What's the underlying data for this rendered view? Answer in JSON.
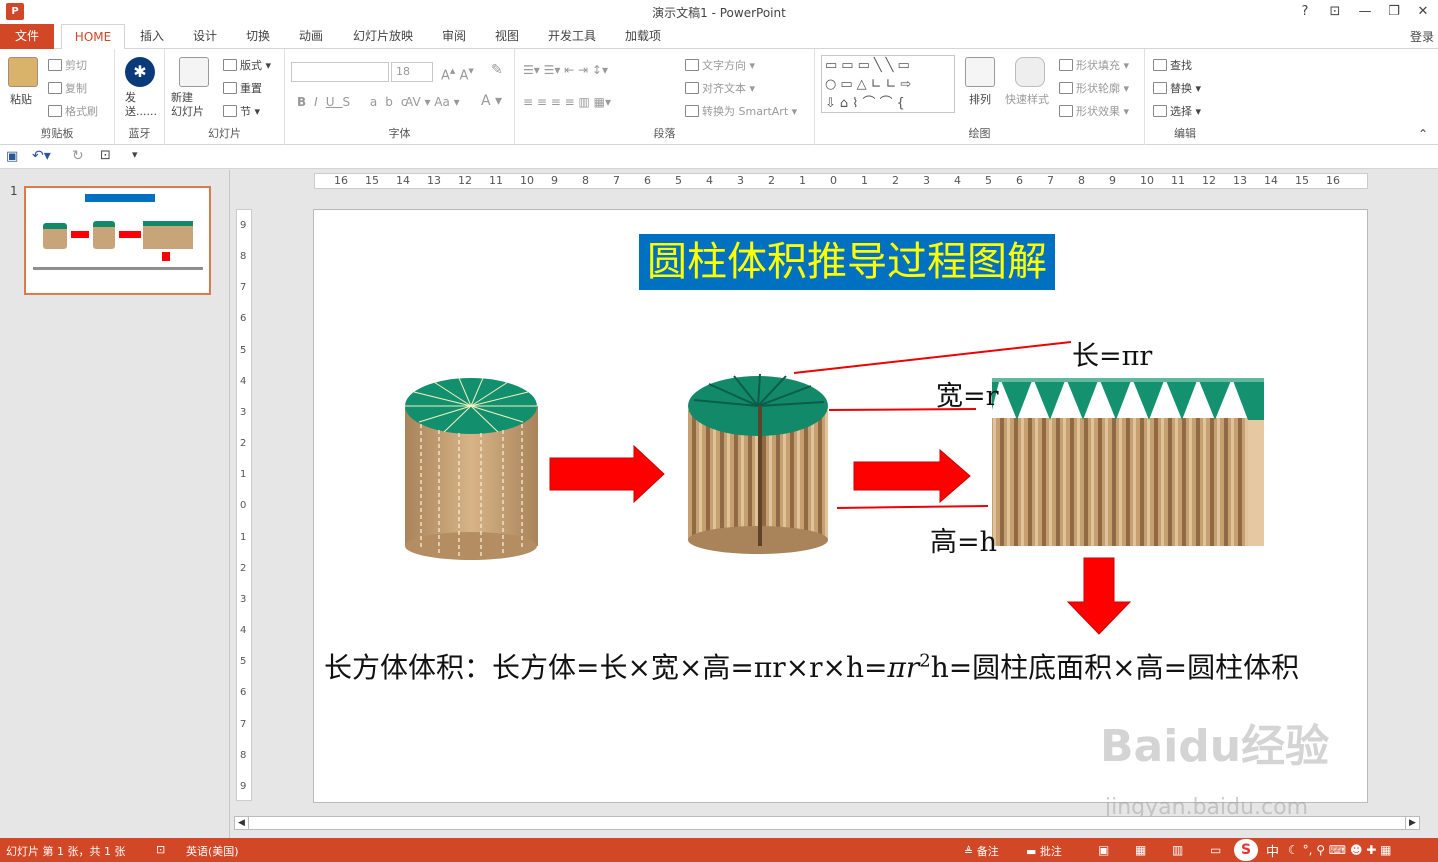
{
  "window": {
    "title": "演示文稿1 - PowerPoint",
    "help": "?",
    "login": "登录"
  },
  "tabs": {
    "file": "文件",
    "home": "HOME",
    "insert": "插入",
    "design": "设计",
    "transitions": "切换",
    "animations": "动画",
    "slideshow": "幻灯片放映",
    "review": "审阅",
    "view": "视图",
    "developer": "开发工具",
    "addins": "加载项"
  },
  "ribbon": {
    "clipboard": {
      "label": "剪贴板",
      "paste": "粘贴",
      "cut": "剪切",
      "copy": "复制",
      "format_painter": "格式刷"
    },
    "bluetooth": {
      "label": "蓝牙",
      "send": "发送......"
    },
    "slides": {
      "label": "幻灯片",
      "new_slide": "新建\n幻灯片",
      "layout": "版式",
      "reset": "重置",
      "section": "节"
    },
    "font": {
      "label": "字体",
      "size": "18"
    },
    "paragraph": {
      "label": "段落",
      "text_direction": "文字方向",
      "align_text": "对齐文本",
      "smartart": "转换为 SmartArt"
    },
    "drawing": {
      "label": "绘图",
      "arrange": "排列",
      "quick_styles": "快速样式",
      "shape_fill": "形状填充",
      "shape_outline": "形状轮廓",
      "shape_effects": "形状效果"
    },
    "editing": {
      "label": "编辑",
      "find": "查找",
      "replace": "替换",
      "select": "选择"
    }
  },
  "thumbnail": {
    "number": "1"
  },
  "rulers": {
    "horizontal": [
      "16",
      "15",
      "14",
      "13",
      "12",
      "11",
      "10",
      "9",
      "8",
      "7",
      "6",
      "5",
      "4",
      "3",
      "2",
      "1",
      "0",
      "1",
      "2",
      "3",
      "4",
      "5",
      "6",
      "7",
      "8",
      "9",
      "10",
      "11",
      "12",
      "13",
      "14",
      "15",
      "16"
    ],
    "vertical": [
      "9",
      "8",
      "7",
      "6",
      "5",
      "4",
      "3",
      "2",
      "1",
      "0",
      "1",
      "2",
      "3",
      "4",
      "5",
      "6",
      "7",
      "8",
      "9"
    ]
  },
  "slide": {
    "title": "圆柱体积推导过程图解",
    "length_label": "长=πr",
    "width_label": "宽=r",
    "height_label": "高=h",
    "formula_prefix": "长方体体积：长方体=长×宽×高=πr×r×h=",
    "formula_pi_r": "πr",
    "formula_exp": "2",
    "formula_suffix": "h=圆柱底面积×高=圆柱体积"
  },
  "status": {
    "slide_info": "幻灯片 第 1 张，共 1 张",
    "language": "英语(美国)",
    "notes": "备注",
    "comments": "批注",
    "ime": "中"
  },
  "watermark": {
    "brand": "Baidu经验",
    "url": "jingyan.baidu.com"
  },
  "colors": {
    "accent": "#d24726",
    "title_bg": "#0070c0",
    "title_text": "#ffff00",
    "arrow": "#ff0000",
    "green_top": "#128a6a",
    "wood": "#c8a479"
  }
}
